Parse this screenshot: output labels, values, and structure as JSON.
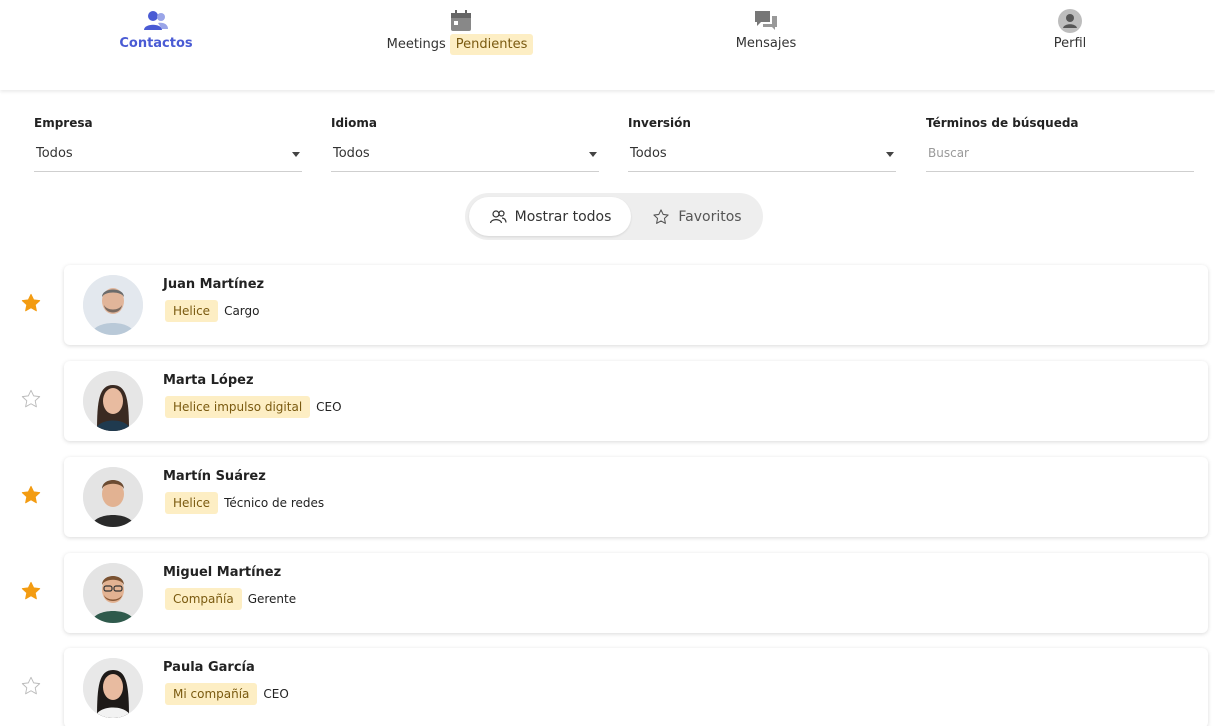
{
  "nav": {
    "contactos": "Contactos",
    "meetings": "Meetings",
    "pendientes": "Pendientes",
    "mensajes": "Mensajes",
    "perfil": "Perfil",
    "accent": "#4a5bd4"
  },
  "filters": {
    "empresa": {
      "label": "Empresa",
      "value": "Todos"
    },
    "idioma": {
      "label": "Idioma",
      "value": "Todos"
    },
    "inversion": {
      "label": "Inversión",
      "value": "Todos"
    },
    "busqueda": {
      "label": "Términos de búsqueda",
      "placeholder": "Buscar"
    }
  },
  "toggle": {
    "all": "Mostrar todos",
    "favorites": "Favoritos"
  },
  "contacts": [
    {
      "name": "Juan Martínez",
      "company": "Helice",
      "role": "Cargo",
      "favorite": true
    },
    {
      "name": "Marta López",
      "company": "Helice impulso digital",
      "role": "CEO",
      "favorite": false
    },
    {
      "name": "Martín Suárez",
      "company": "Helice",
      "role": "Técnico de redes",
      "favorite": true
    },
    {
      "name": "Miguel Martínez",
      "company": "Compañía",
      "role": "Gerente",
      "favorite": true
    },
    {
      "name": "Paula García",
      "company": "Mi compañía",
      "role": "CEO",
      "favorite": false
    }
  ],
  "colors": {
    "star_on": "#f39c12",
    "star_off": "#bbbbbb",
    "tag_bg": "#fdeec4"
  }
}
